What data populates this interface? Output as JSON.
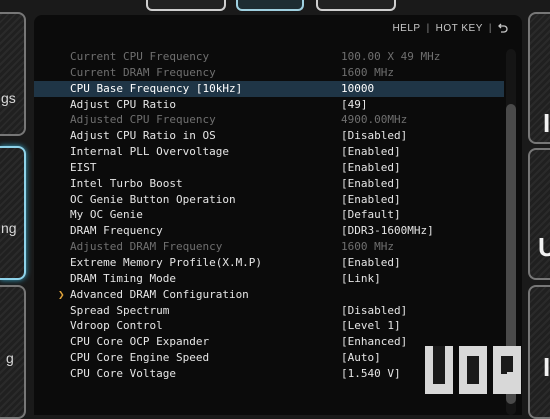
{
  "toolbar": {
    "help": "HELP",
    "separator": "|",
    "hotkey": "HOT KEY",
    "back_icon": "back-arrow-icon"
  },
  "side_labels": {
    "left_top": "gs",
    "left_mid": "ng",
    "left_bot": "g",
    "right_top": "I",
    "right_mid": "U",
    "right_bot": "I"
  },
  "settings": [
    {
      "label": "Current CPU Frequency",
      "value": "100.00 X 49 MHz",
      "state": "dim"
    },
    {
      "label": "Current DRAM Frequency",
      "value": "1600 MHz",
      "state": "dim"
    },
    {
      "label": "CPU Base Frequency [10kHz]",
      "value": "10000",
      "state": "selected"
    },
    {
      "label": "Adjust CPU Ratio",
      "value": "[49]",
      "state": "normal"
    },
    {
      "label": "Adjusted CPU Frequency",
      "value": "4900.00MHz",
      "state": "dim"
    },
    {
      "label": "Adjust CPU Ratio in OS",
      "value": "[Disabled]",
      "state": "normal"
    },
    {
      "label": "Internal PLL Overvoltage",
      "value": "[Enabled]",
      "state": "normal"
    },
    {
      "label": "EIST",
      "value": "[Enabled]",
      "state": "normal"
    },
    {
      "label": "Intel Turbo Boost",
      "value": "[Enabled]",
      "state": "normal"
    },
    {
      "label": "OC Genie Button Operation",
      "value": "[Enabled]",
      "state": "normal"
    },
    {
      "label": "My OC Genie",
      "value": "[Default]",
      "state": "normal"
    },
    {
      "label": "DRAM Frequency",
      "value": "[DDR3-1600MHz]",
      "state": "normal"
    },
    {
      "label": "Adjusted DRAM Frequency",
      "value": "1600 MHz",
      "state": "dim"
    },
    {
      "label": "Extreme Memory Profile(X.M.P)",
      "value": "[Enabled]",
      "state": "normal"
    },
    {
      "label": "DRAM Timing Mode",
      "value": "[Link]",
      "state": "normal"
    },
    {
      "label": "Advanced DRAM Configuration",
      "value": "",
      "state": "submenu"
    },
    {
      "label": "Spread Spectrum",
      "value": "[Disabled]",
      "state": "normal"
    },
    {
      "label": "Vdroop Control",
      "value": "[Level 1]",
      "state": "normal"
    },
    {
      "label": "CPU Core OCP Expander",
      "value": "[Enhanced]",
      "state": "normal"
    },
    {
      "label": "CPU Core Engine Speed",
      "value": "[Auto]",
      "state": "normal"
    },
    {
      "label": "CPU Core Voltage",
      "value": "[1.540 V]",
      "state": "normal"
    }
  ],
  "submenu_marker": "❯",
  "colors": {
    "selected_row": "#1f3546",
    "dim_text": "#6f6f6f",
    "submenu_arrow": "#e2a43b",
    "active_tab": "#8fd3ea"
  },
  "scroll": {
    "position_fraction": 0.15,
    "visible_fraction": 0.82
  }
}
